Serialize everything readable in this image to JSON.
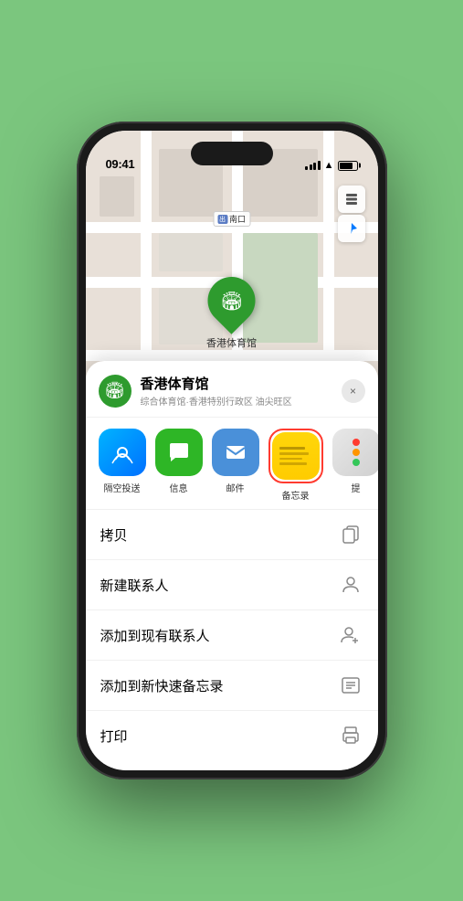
{
  "status": {
    "time": "09:41",
    "location_arrow": "▶"
  },
  "map": {
    "exit_label": "南口",
    "exit_box": "出",
    "stadium_name": "香港体育馆",
    "map_btn_layers": "⊞",
    "map_btn_location": "◎"
  },
  "location_card": {
    "name": "香港体育馆",
    "subtitle": "综合体育馆·香港特别行政区 油尖旺区",
    "close_label": "×"
  },
  "share_items": [
    {
      "id": "airdrop",
      "label": "隔空投送",
      "icon": "📡",
      "style": "airdrop"
    },
    {
      "id": "message",
      "label": "信息",
      "icon": "💬",
      "style": "message"
    },
    {
      "id": "mail",
      "label": "邮件",
      "icon": "✉",
      "style": "mail"
    },
    {
      "id": "notes",
      "label": "备忘录",
      "icon": "notes",
      "style": "notes"
    },
    {
      "id": "more",
      "label": "提",
      "icon": "more",
      "style": "more"
    }
  ],
  "action_rows": [
    {
      "label": "拷贝",
      "icon": "copy"
    },
    {
      "label": "新建联系人",
      "icon": "person"
    },
    {
      "label": "添加到现有联系人",
      "icon": "person-add"
    },
    {
      "label": "添加到新快速备忘录",
      "icon": "memo"
    },
    {
      "label": "打印",
      "icon": "print"
    }
  ]
}
